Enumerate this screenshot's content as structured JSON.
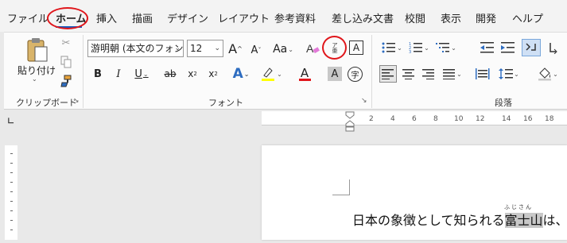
{
  "menu": {
    "tabs": [
      "ファイル",
      "ホーム",
      "挿入",
      "描画",
      "デザイン",
      "レイアウト",
      "参考資料",
      "差し込み文書",
      "校閲",
      "表示",
      "開発",
      "ヘルプ"
    ],
    "active": "ホーム"
  },
  "groups": {
    "clipboard": "クリップボード",
    "font": "フォント",
    "paragraph": "段落"
  },
  "clipboard": {
    "paste_label": "貼り付け"
  },
  "font": {
    "name": "游明朝 (本文のフォン",
    "size": "12",
    "grow": "A",
    "shrink": "A",
    "case": "Aa",
    "bold": "B",
    "italic": "I",
    "underline": "U",
    "strike": "ab",
    "subscript": "x",
    "superscript": "x",
    "text_effects": "A",
    "font_color": "A",
    "char_shading": "A",
    "enclose": "字",
    "phonetic_small": "ア\n亜",
    "char_border": "A"
  },
  "ruler": {
    "numbers": [
      "2",
      "4",
      "6",
      "8",
      "10",
      "12",
      "14",
      "16",
      "18"
    ]
  },
  "document": {
    "text_before": "日本の象徴として知られる",
    "highlight": "富士山",
    "text_after": "は、",
    "ruby": "ふじさん"
  },
  "colors": {
    "accent": "#185abd",
    "annotation": "#e0161b",
    "font_color_bar": "#e0161b",
    "highlight_bar": "#ffff00"
  }
}
